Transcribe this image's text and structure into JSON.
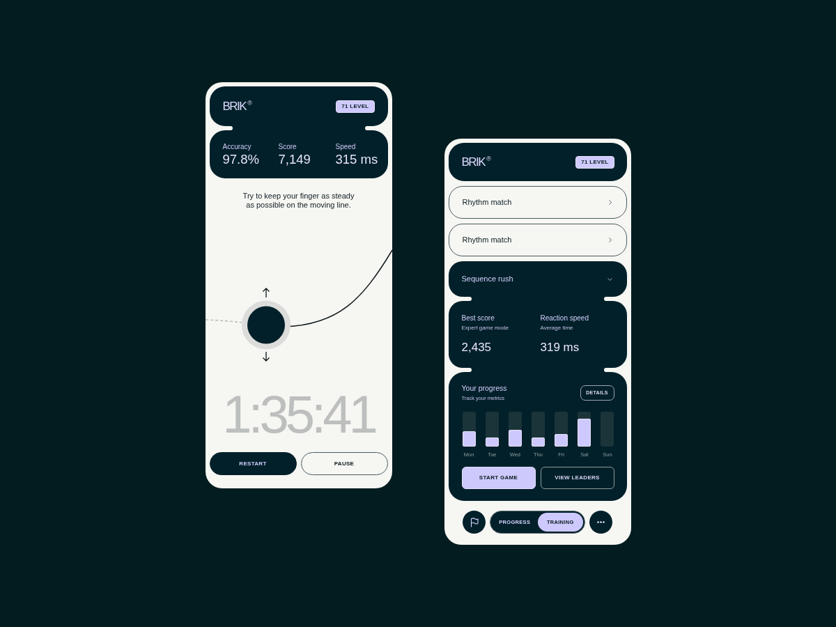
{
  "game_screen": {
    "header": {
      "logo": "BRIK$^{®}$",
      "badge": "71 LEVEL"
    },
    "stats": [
      {
        "label": "Accuracy",
        "value": "97.8%"
      },
      {
        "label": "Score",
        "value": "7,149"
      },
      {
        "label": "Speed",
        "value": "315 ms"
      }
    ],
    "instruction": "Try to keep your finger as steady as possible on the moving line.",
    "timer": "1:35:41",
    "buttons": [
      {
        "label": "RESTART",
        "kind": "filled"
      },
      {
        "label": "PAUSE",
        "kind": "outline"
      }
    ]
  },
  "menu_screen": {
    "header": {
      "logo": "BRIK$^{®}$",
      "badge": "71 LEVEL"
    },
    "games": [
      {
        "label": "Rhythm match",
        "expanded": false
      },
      {
        "label": "Rhythm match",
        "expanded": false
      },
      {
        "label": "Sequence rush",
        "expanded": true
      }
    ],
    "stats": [
      {
        "label": "Best score",
        "sublabel": "Expert game mode",
        "value": "2,435"
      },
      {
        "label": "Reaction speed",
        "sublabel": "Average time",
        "value": "319 ms"
      }
    ],
    "progress": {
      "title": "Your progress",
      "subtitle": "Track your metrics",
      "action": "DETAILS",
      "days": [
        {
          "label": "Mon",
          "level": 0.44
        },
        {
          "label": "Tue",
          "level": 0.26
        },
        {
          "label": "Wed",
          "level": 0.48
        },
        {
          "label": "Thu",
          "level": 0.26
        },
        {
          "label": "Fri",
          "level": 0.36
        },
        {
          "label": "Sat",
          "level": 0.8
        },
        {
          "label": "Sun"
        }
      ]
    },
    "buttons": [
      {
        "label": "START GAME",
        "kind": "filled"
      },
      {
        "label": "VIEW LEADERS",
        "kind": "outline"
      }
    ],
    "tab_bar": {
      "tabs": [
        {
          "label": "PROGRESS",
          "selected": false
        },
        {
          "label": "TRAINING",
          "selected": true
        }
      ]
    }
  }
}
